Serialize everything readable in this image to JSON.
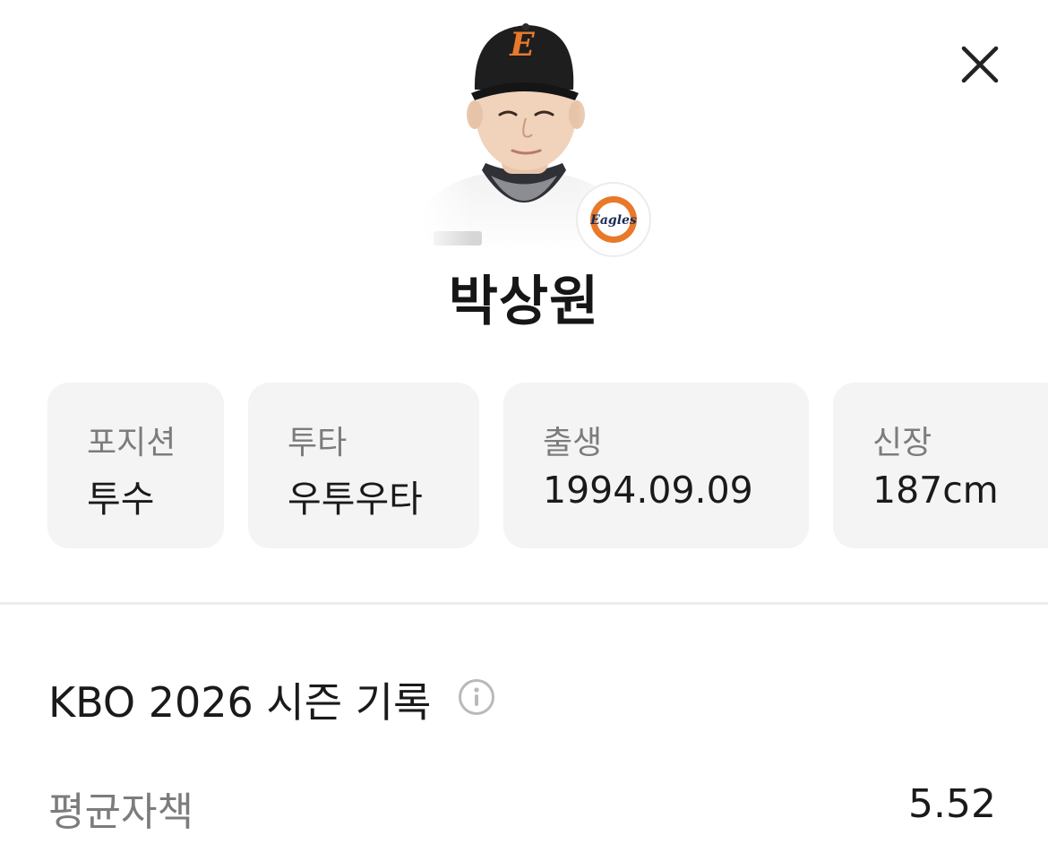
{
  "player": {
    "name": "박상원",
    "team_badge_text": "Eagles",
    "cap_letter": "E"
  },
  "info_cards": [
    {
      "label": "포지션",
      "value": "투수"
    },
    {
      "label": "투타",
      "value": "우투우타"
    },
    {
      "label": "출생",
      "value": "1994.09.09"
    },
    {
      "label": "신장",
      "value": "187cm"
    }
  ],
  "season": {
    "title": "KBO 2026 시즌 기록",
    "stats": [
      {
        "label": "평균자책",
        "value": "5.52"
      }
    ]
  },
  "colors": {
    "team_orange": "#e8792b",
    "cap_black": "#1e1e1e",
    "card_bg": "#f4f4f4",
    "muted_text": "#7c7c7c"
  },
  "icons": {
    "close": "close-icon",
    "info": "info-icon"
  }
}
